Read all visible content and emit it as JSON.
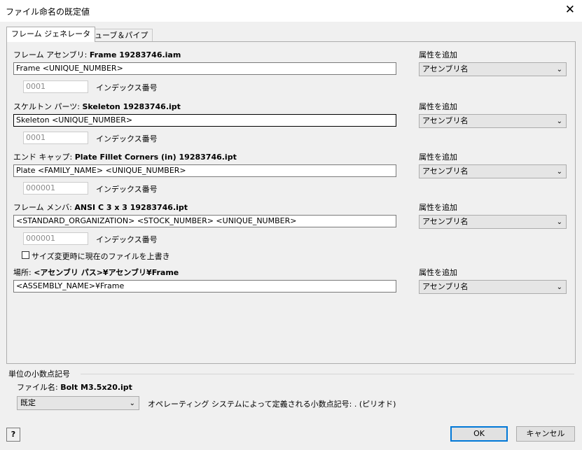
{
  "window": {
    "title": "ファイル命名の既定値",
    "close_glyph": "✕"
  },
  "tabs": [
    {
      "label": "フレーム ジェネレータ",
      "active": true
    },
    {
      "label": "チューブ＆パイプ",
      "active": false
    }
  ],
  "frame_assembly": {
    "label": "フレーム アセンブリ:",
    "filename": "Frame 19283746.iam",
    "value": "Frame <UNIQUE_NUMBER>",
    "index_value": "0001",
    "index_label": "インデックス番号",
    "attr_label": "属性を追加",
    "attr_value": "アセンブリ名"
  },
  "skeleton_part": {
    "label": "スケルトン パーツ:",
    "filename": "Skeleton 19283746.ipt",
    "value": "Skeleton <UNIQUE_NUMBER>",
    "index_value": "0001",
    "index_label": "インデックス番号",
    "attr_label": "属性を追加",
    "attr_value": "アセンブリ名"
  },
  "end_cap": {
    "label": "エンド キャップ:",
    "filename": "Plate Fillet Corners (in) 19283746.ipt",
    "value": "Plate <FAMILY_NAME> <UNIQUE_NUMBER>",
    "index_value": "000001",
    "index_label": "インデックス番号",
    "attr_label": "属性を追加",
    "attr_value": "アセンブリ名"
  },
  "frame_member": {
    "label": "フレーム メンバ:",
    "filename": "ANSI C 3 x 3 19283746.ipt",
    "value": "<STANDARD_ORGANIZATION> <STOCK_NUMBER> <UNIQUE_NUMBER>",
    "index_value": "000001",
    "index_label": "インデックス番号",
    "attr_label": "属性を追加",
    "attr_value": "アセンブリ名",
    "overwrite_label": "サイズ変更時に現在のファイルを上書き"
  },
  "location": {
    "label": "場所:",
    "path": "<アセンブリ パス>¥アセンブリ¥Frame",
    "value": "<ASSEMBLY_NAME>¥Frame",
    "attr_label": "属性を追加",
    "attr_value": "アセンブリ名"
  },
  "decimal": {
    "section_title": "単位の小数点記号",
    "filename_label": "ファイル名:",
    "filename": "Bolt M3.5x20.ipt",
    "select_value": "既定",
    "note": "オペレーティング システムによって定義される小数点記号: . (ピリオド)"
  },
  "buttons": {
    "help": "?",
    "ok": "OK",
    "cancel": "キャンセル"
  }
}
